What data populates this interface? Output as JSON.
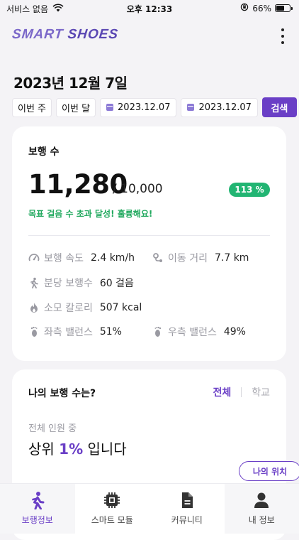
{
  "status_bar": {
    "carrier": "서비스 없음",
    "time": "오후 12:33",
    "battery": "66%",
    "battery_level": 0.66
  },
  "header": {
    "logo_part1": "SMART ",
    "logo_part2": "SHOES"
  },
  "date_title": "2023년 12월 7일",
  "filters": {
    "this_week": "이번 주",
    "this_month": "이번 달",
    "start_date": "2023.12.07",
    "end_date": "2023.12.07",
    "search": "검색"
  },
  "walk_card": {
    "title": "보행 수",
    "steps": "11,280",
    "goal": "/ 10,000",
    "percent": "113 %",
    "message": "목표 걸음 수 초과 달성! 훌륭해요!",
    "stats": {
      "speed": {
        "label": "보행 속도",
        "value": "2.4 km/h"
      },
      "distance": {
        "label": "이동 거리",
        "value": "7.7 km"
      },
      "cadence": {
        "label": "분당 보행수",
        "value": "60 걸음"
      },
      "calories": {
        "label": "소모 칼로리",
        "value": "507 kcal"
      },
      "left_balance": {
        "label": "좌측 밸런스",
        "value": "51%"
      },
      "right_balance": {
        "label": "우측 밸런스",
        "value": "49%"
      }
    }
  },
  "rank_card": {
    "title": "나의 보행 수는?",
    "tabs": {
      "all": "전체",
      "school": "학교"
    },
    "subtitle": "전체 인원 중",
    "rank_prefix": "상위 ",
    "rank_value": "1%",
    "rank_suffix": " 입니다",
    "my_location": "나의 위치"
  },
  "bottom_nav": {
    "walk_info": "보행정보",
    "smart_module": "스마트 모듈",
    "community": "커뮤니티",
    "my_info": "내 정보"
  },
  "colors": {
    "accent": "#6a3fc6",
    "success": "#22b573"
  }
}
